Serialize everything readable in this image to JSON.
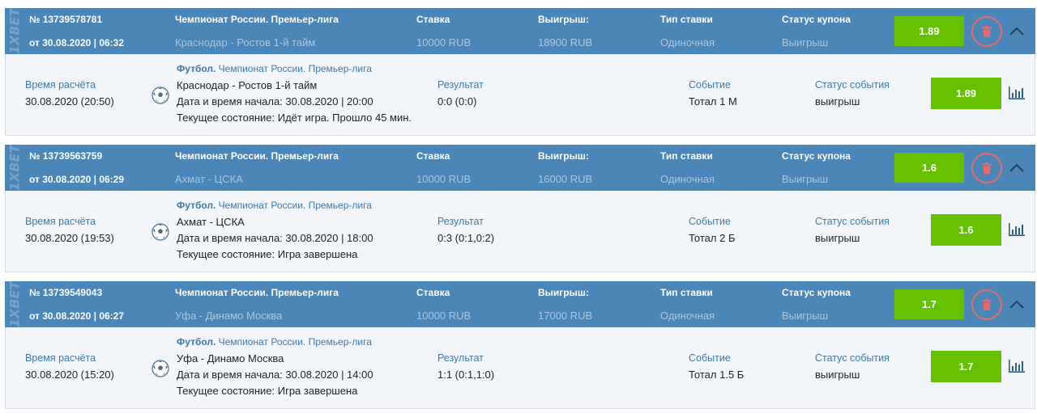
{
  "brand": "1XBET",
  "header_labels": {
    "stake": "Ставка",
    "win": "Выигрыш:",
    "bet_type": "Тип ставки",
    "coupon_status": "Статус купона"
  },
  "body_labels": {
    "calc_time": "Время расчёта",
    "result": "Результат",
    "event": "Событие",
    "event_status": "Статус события"
  },
  "coupons": [
    {
      "number": "№ 13739578781",
      "date": "от 30.08.2020 | 06:32",
      "league": "Чемпионат России. Премьер-лига",
      "match": "Краснодар - Ростов 1-й тайм",
      "stake": "10000 RUB",
      "win": "18900 RUB",
      "bet_type": "Одиночная",
      "coupon_status": "Выигрыш",
      "odds": "1.89",
      "calc_time": "30.08.2020 (20:50)",
      "sport": "Футбол.",
      "sport_league": " Чемпионат России. Премьер-лига",
      "event_name": "Краснодар - Ростов 1-й тайм",
      "start": "Дата и время начала: 30.08.2020 | 20:00",
      "state": "Текущее состояние: Идёт игра. Прошло 45 мин.",
      "result": "0:0 (0:0)",
      "event": "Тотал 1 М",
      "event_status": "выигрыш",
      "event_odds": "1.89"
    },
    {
      "number": "№ 13739563759",
      "date": "от 30.08.2020 | 06:29",
      "league": "Чемпионат России. Премьер-лига",
      "match": "Ахмат - ЦСКА",
      "stake": "10000 RUB",
      "win": "16000 RUB",
      "bet_type": "Одиночная",
      "coupon_status": "Выигрыш",
      "odds": "1.6",
      "calc_time": "30.08.2020 (19:53)",
      "sport": "Футбол.",
      "sport_league": " Чемпионат России. Премьер-лига",
      "event_name": "Ахмат - ЦСКА",
      "start": "Дата и время начала: 30.08.2020 | 18:00",
      "state": "Текущее состояние: Игра завершена",
      "result": "0:3 (0:1,0:2)",
      "event": "Тотал 2 Б",
      "event_status": "выигрыш",
      "event_odds": "1.6"
    },
    {
      "number": "№ 13739549043",
      "date": "от 30.08.2020 | 06:27",
      "league": "Чемпионат России. Премьер-лига",
      "match": "Уфа - Динамо Москва",
      "stake": "10000 RUB",
      "win": "17000 RUB",
      "bet_type": "Одиночная",
      "coupon_status": "Выигрыш",
      "odds": "1.7",
      "calc_time": "30.08.2020 (15:20)",
      "sport": "Футбол.",
      "sport_league": " Чемпионат России. Премьер-лига",
      "event_name": "Уфа - Динамо Москва",
      "start": "Дата и время начала: 30.08.2020 | 14:00",
      "state": "Текущее состояние: Игра завершена",
      "result": "1:1 (0:1,1:0)",
      "event": "Тотал 1.5 Б",
      "event_status": "выигрыш",
      "event_odds": "1.7"
    }
  ],
  "colors": {
    "header_bg": "#4a86b8",
    "body_bg": "#f2f6fb",
    "odds_green": "#66c100",
    "delete_red": "#e86a6a",
    "label_blue": "#3f78aa"
  },
  "icons": {
    "delete": "trash-icon",
    "collapse": "chevron-up-icon",
    "sport": "soccer-ball-icon",
    "stats": "bar-chart-icon"
  }
}
